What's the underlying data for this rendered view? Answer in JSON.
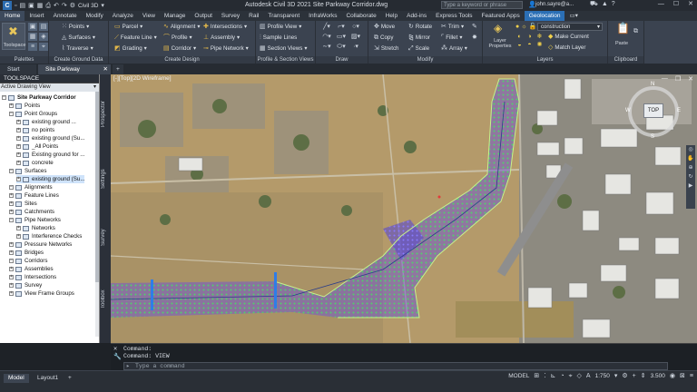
{
  "app": {
    "title": "Autodesk Civil 3D 2021   Site Parkway Corridor.dwg",
    "workspace": "Civil 3D",
    "search_placeholder": "Type a keyword or phrase",
    "user": "john.sayre@a...",
    "help_icon": "?"
  },
  "ribbon_tabs": [
    "Home",
    "Insert",
    "Annotate",
    "Modify",
    "Analyze",
    "View",
    "Manage",
    "Output",
    "Survey",
    "Rail",
    "Transparent",
    "InfraWorks",
    "Collaborate",
    "Help",
    "Add-ins",
    "Express Tools",
    "Featured Apps",
    "Geolocation"
  ],
  "ribbon": {
    "toolspace": "Toolspace",
    "palettes": "Palettes",
    "create_ground_data": {
      "title": "Create Ground Data",
      "points": "Points",
      "surfaces": "Surfaces",
      "traverse": "Traverse"
    },
    "create_design": {
      "title": "Create Design",
      "parcel": "Parcel",
      "feature_line": "Feature Line",
      "grading": "Grading",
      "alignment": "Alignment",
      "profile": "Profile",
      "corridor": "Corridor",
      "intersections": "Intersections",
      "assembly": "Assembly",
      "pipe_network": "Pipe Network"
    },
    "profile_section": {
      "title": "Profile & Section Views",
      "profile_view": "Profile View",
      "sample_lines": "Sample Lines",
      "section_views": "Section Views"
    },
    "draw": {
      "title": "Draw"
    },
    "modify": {
      "title": "Modify",
      "move": "Move",
      "copy": "Copy",
      "stretch": "Stretch",
      "rotate": "Rotate",
      "mirror": "Mirror",
      "scale": "Scale",
      "trim": "Trim",
      "fillet": "Fillet",
      "array": "Array"
    },
    "layers": {
      "title": "Layers",
      "layer_properties": "Layer Properties",
      "current_layer": "construction",
      "make_current": "Make Current",
      "match_layer": "Match Layer"
    },
    "clipboard": {
      "title": "Clipboard",
      "paste": "Paste"
    }
  },
  "doc_tabs": [
    "Start",
    "Site Parkway Corridor*"
  ],
  "toolspace": {
    "header": "TOOLSPACE",
    "view": "Active Drawing View",
    "items": [
      {
        "label": "Site Parkway Corridor",
        "level": 0
      },
      {
        "label": "Points",
        "level": 1
      },
      {
        "label": "Point Groups",
        "level": 1
      },
      {
        "label": "existing ground ...",
        "level": 2
      },
      {
        "label": "no points",
        "level": 2
      },
      {
        "label": "existing ground (Su...",
        "level": 2
      },
      {
        "label": "_All Points",
        "level": 2
      },
      {
        "label": "Existing ground for ...",
        "level": 2
      },
      {
        "label": "concrete",
        "level": 2
      },
      {
        "label": "Surfaces",
        "level": 1
      },
      {
        "label": "existing ground (Su...",
        "level": 2
      },
      {
        "label": "Alignments",
        "level": 1
      },
      {
        "label": "Feature Lines",
        "level": 1
      },
      {
        "label": "Sites",
        "level": 1
      },
      {
        "label": "Catchments",
        "level": 1
      },
      {
        "label": "Pipe Networks",
        "level": 1
      },
      {
        "label": "Networks",
        "level": 2
      },
      {
        "label": "Interference Checks",
        "level": 2
      },
      {
        "label": "Pressure Networks",
        "level": 1
      },
      {
        "label": "Bridges",
        "level": 1
      },
      {
        "label": "Corridors",
        "level": 1
      },
      {
        "label": "Assemblies",
        "level": 1
      },
      {
        "label": "Intersections",
        "level": 1
      },
      {
        "label": "Survey",
        "level": 1
      },
      {
        "label": "View Frame Groups",
        "level": 1
      }
    ]
  },
  "side_tabs": [
    "Prospector",
    "Settings",
    "Survey",
    "Toolbox"
  ],
  "viewport": {
    "label": "[-][Top][2D Wireframe]",
    "compass": "TOP",
    "n": "N",
    "s": "S",
    "e": "E",
    "w": "W"
  },
  "command": {
    "line1": "Command:",
    "line2": "Command: VIEW",
    "placeholder": "Type a command"
  },
  "layouts": [
    "Model",
    "Layout1"
  ],
  "status": {
    "model": "MODEL",
    "scale": "1:750",
    "elevation": "3.500"
  },
  "colors": {
    "accent": "#2b6fb5",
    "corridor_purple": "#7b5cf0",
    "corridor_green": "#3ecf6a",
    "sky": "#2b3039"
  }
}
